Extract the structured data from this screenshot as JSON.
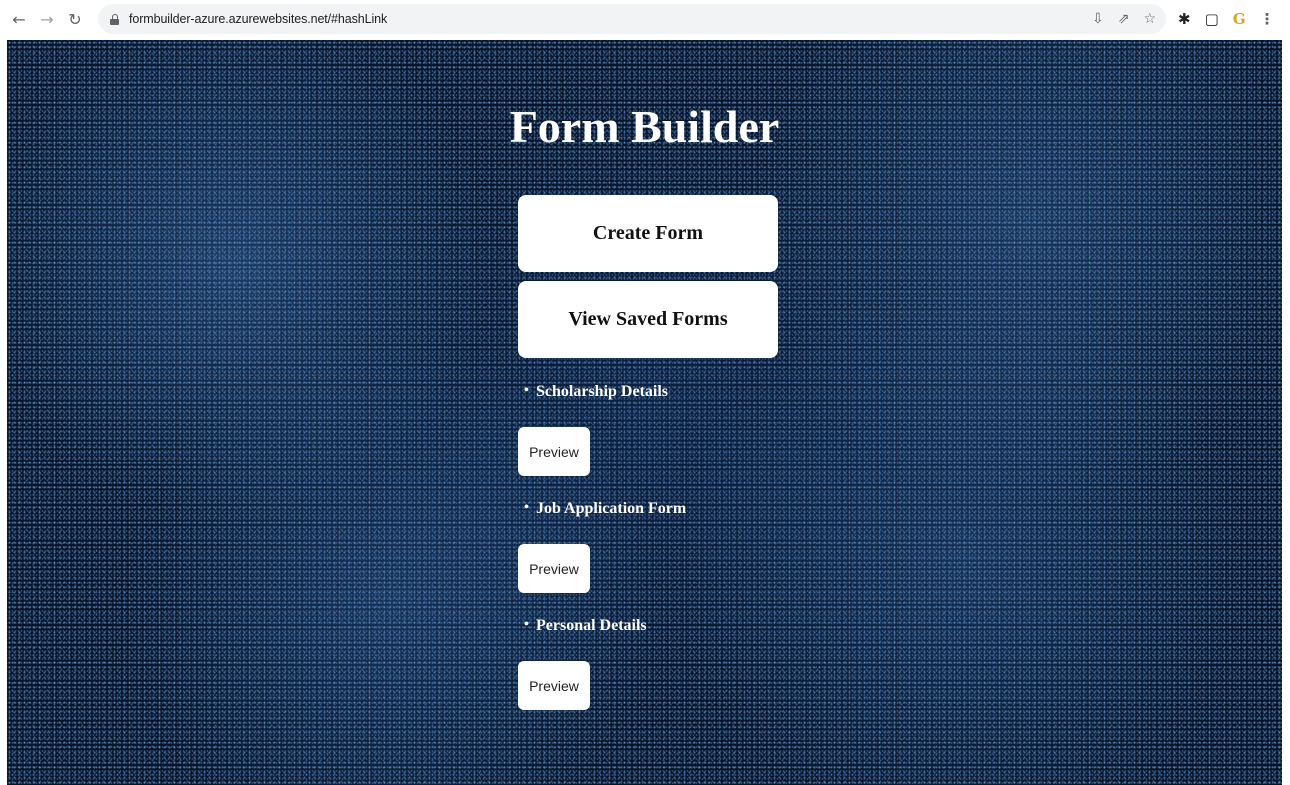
{
  "browser": {
    "url": "formbuilder-azure.azurewebsites.net/#hashLink",
    "icons": [
      "back-arrow-icon",
      "forward-arrow-icon",
      "reload-icon",
      "lock-icon",
      "install-icon",
      "share-icon",
      "bookmark-star-icon",
      "extensions-puzzle-icon",
      "side-panel-icon",
      "grammarly-g-icon",
      "menu-kebab-icon"
    ]
  },
  "page": {
    "title": "Form Builder",
    "create_button": "Create Form",
    "view_button": "View Saved Forms",
    "forms": [
      {
        "name": "Scholarship Details",
        "preview_label": "Preview"
      },
      {
        "name": "Job Application Form",
        "preview_label": "Preview"
      },
      {
        "name": "Personal Details",
        "preview_label": "Preview"
      }
    ]
  },
  "colors": {
    "background": "#07152c",
    "button_bg": "#ffffff",
    "title_text": "#ffffff"
  }
}
